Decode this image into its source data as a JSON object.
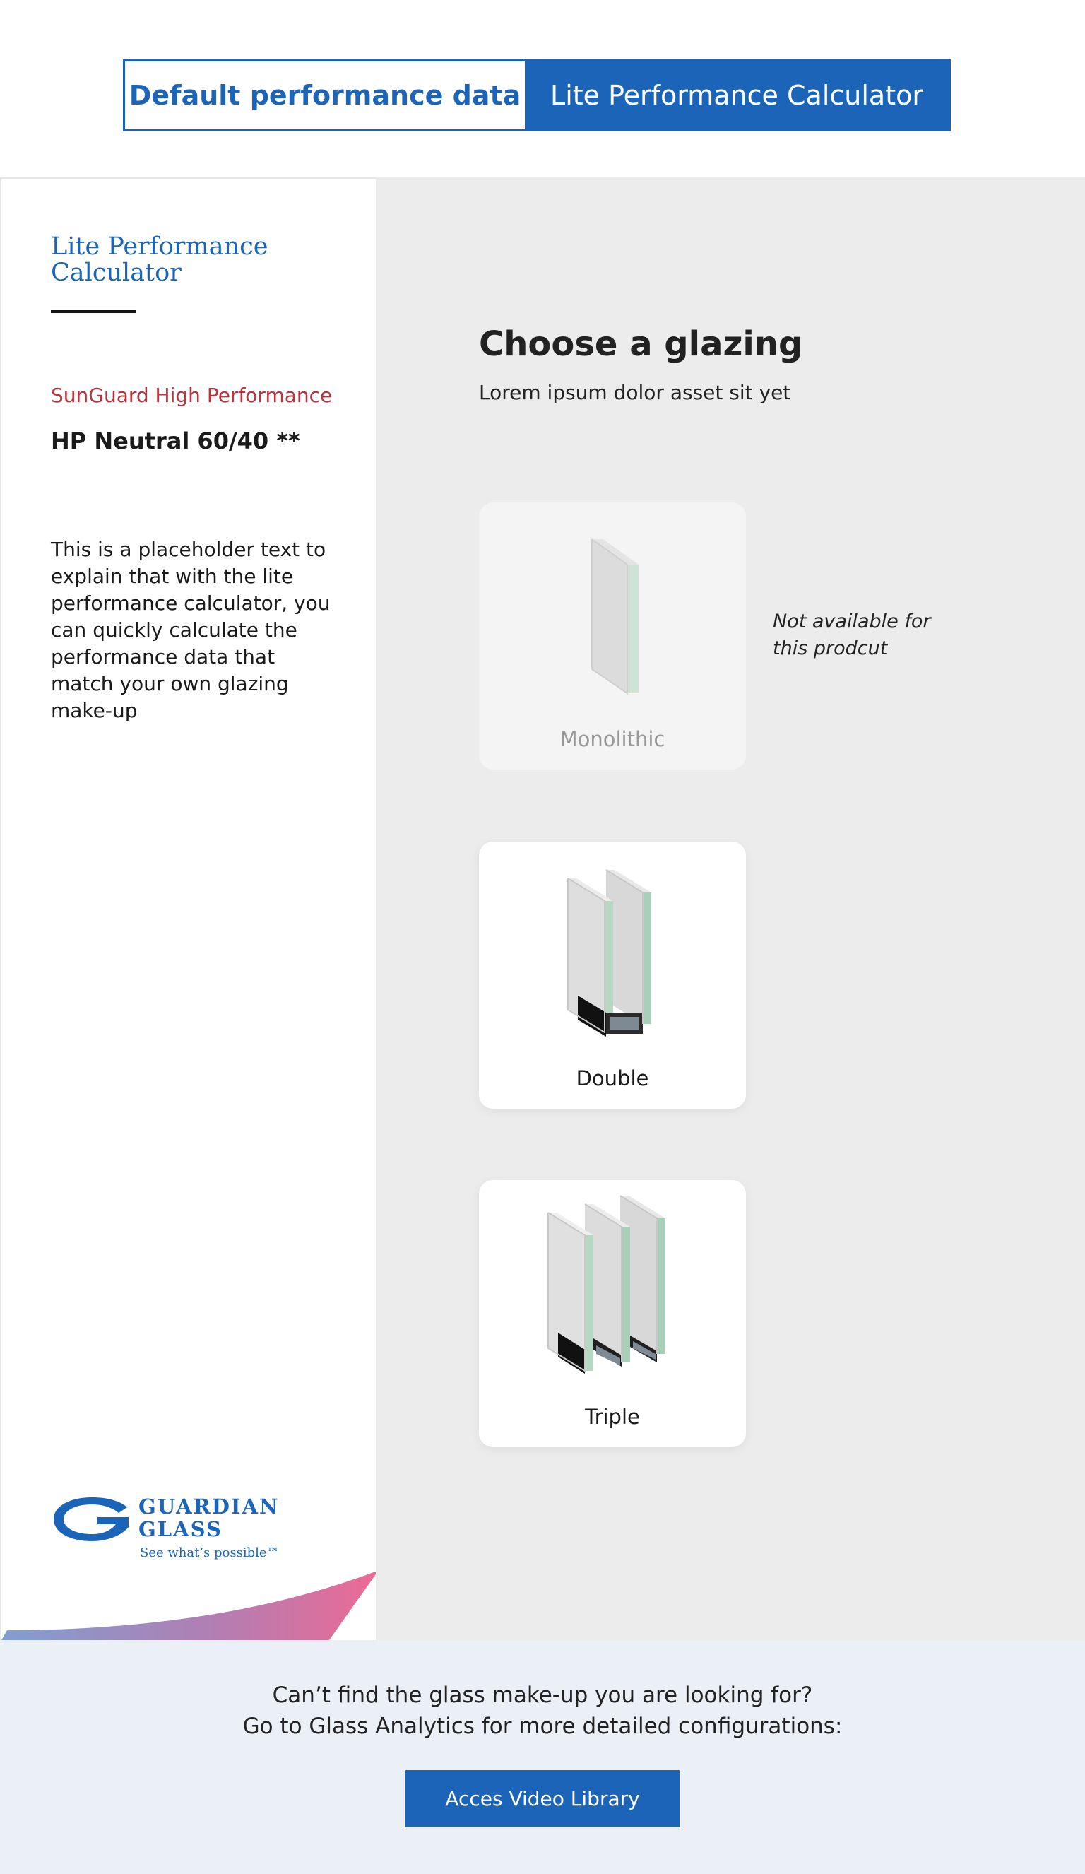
{
  "tabs": [
    {
      "label": "Default performance data",
      "active": false
    },
    {
      "label": "Lite Performance Calculator",
      "active": true
    }
  ],
  "sidebar": {
    "title_line1": "Lite Performance",
    "title_line2": "Calculator",
    "brand": "SunGuard High Performance",
    "product": "HP Neutral 60/40 **",
    "description": "This is a placeholder text to explain that with the lite performance calculator, you can quickly calculate the performance data that match your own glazing make-up",
    "logo": {
      "line1": "GUARDIAN",
      "line2": "GLASS",
      "tagline": "See what’s possible™"
    }
  },
  "main": {
    "heading": "Choose a glazing",
    "subheading": "Lorem ipsum dolor asset sit yet",
    "options": [
      {
        "label": "Monolithic",
        "available": false,
        "icon": "monolithic-glass-icon"
      },
      {
        "label": "Double",
        "available": true,
        "icon": "double-glazing-icon"
      },
      {
        "label": "Triple",
        "available": true,
        "icon": "triple-glazing-icon"
      }
    ],
    "not_available_note": "Not available for this prodcut"
  },
  "footer": {
    "line1": "Can’t find the glass make-up you are looking for?",
    "line2": "Go to Glass Analytics for more detailed configurations:",
    "button_label": "Acces Video Library"
  },
  "colors": {
    "brand_blue": "#1b64b8",
    "brand_red": "#b8343d",
    "content_bg": "#ececec",
    "footer_bg": "#ebf0f7"
  }
}
